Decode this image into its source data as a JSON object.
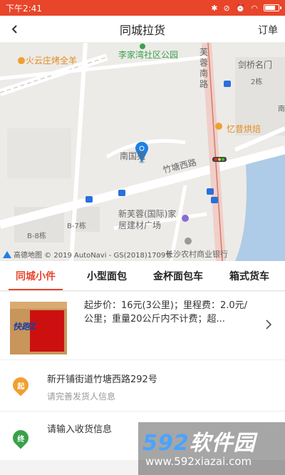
{
  "status_bar": {
    "time": "下午2:41",
    "icons": [
      "bluetooth-icon",
      "silent-icon",
      "alarm-icon",
      "wifi-icon",
      "battery-icon"
    ],
    "battery_level": 0.8
  },
  "header": {
    "title": "同城拉货",
    "orders_label": "订单",
    "back_icon": "back-arrow-icon"
  },
  "map": {
    "labels": {
      "restaurant": "火云庄烤全羊",
      "park": "李家湾社区公园",
      "community": "剑桥名门",
      "road_vertical": "芙蓉南路",
      "bakery": "忆昔烘焙",
      "residence": "南国苑",
      "road_zhutang": "竹塘西路",
      "building_market": "新芙蓉(国际)家居建材广场",
      "bank": "长沙农村商业银行",
      "block_b8": "B-8栋",
      "block_b7": "B-7栋",
      "block_2": "2栋",
      "south": "南"
    },
    "copyright": "高德地图 © 2019 AutoNavi - GS(2018)1709号",
    "colors": {
      "road": "#ffffff",
      "main_road": "#f3d6d0",
      "water": "#aecbe7",
      "marker": "#1f7fe0"
    }
  },
  "tabs": [
    {
      "label": "同城小件",
      "active": true
    },
    {
      "label": "小型面包",
      "active": false
    },
    {
      "label": "金杯面包车",
      "active": false
    },
    {
      "label": "箱式货车",
      "active": false
    }
  ],
  "vehicle": {
    "image_text": "快跑Z",
    "description": "起步价：16元(3公里)；里程费：2.0元/公里；重量20公斤内不计费；超..."
  },
  "address": {
    "start_badge": "起",
    "start_address": "新开铺街道竹塘西路292号",
    "start_hint": "请完善发货人信息",
    "end_badge": "终",
    "end_hint": "请输入收货信息"
  },
  "watermark": {
    "brand_num": "592",
    "brand_text": "软件园",
    "url": "www.592xiazai.com"
  },
  "accent_color": "#e8452a"
}
